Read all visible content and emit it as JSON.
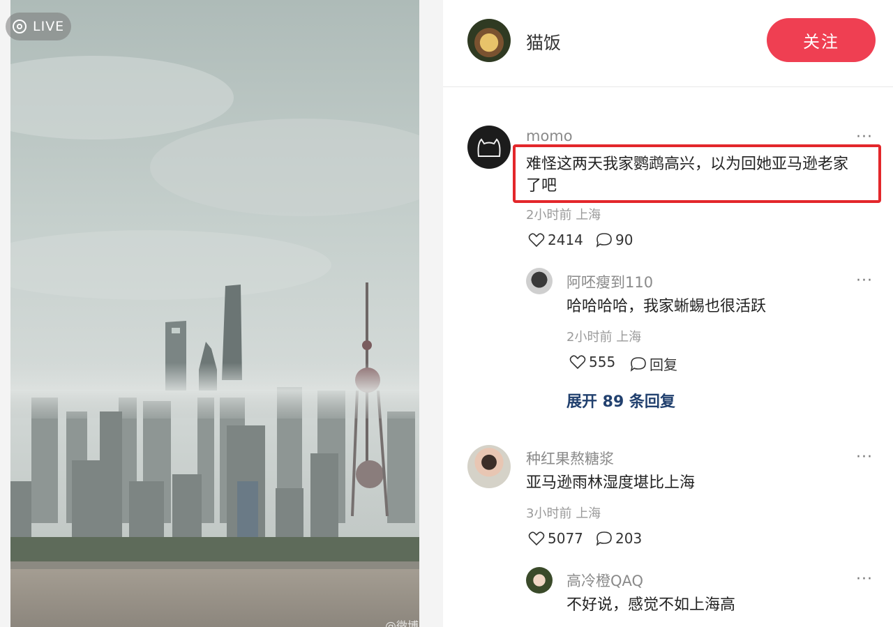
{
  "photo": {
    "live_label": "LIVE",
    "watermark": "@微博"
  },
  "header": {
    "author_name": "猫饭",
    "follow_label": "关注"
  },
  "comments": [
    {
      "user": "momo",
      "text_line1": "难怪这两天我家鹦鹉高兴，以为回她亚马逊老家",
      "text_line2": "了吧",
      "time": "2小时前",
      "location": "上海",
      "likes": "2414",
      "replies": "90",
      "highlighted": true,
      "sub_reply": {
        "user": "阿呸瘦到110",
        "text": "哈哈哈哈，我家蜥蜴也很活跃",
        "time": "2小时前",
        "location": "上海",
        "likes": "555",
        "reply_label": "回复"
      },
      "expand_label": "展开 89 条回复"
    },
    {
      "user": "种红果熬糖浆",
      "text": "亚马逊雨林湿度堪比上海",
      "time": "3小时前",
      "location": "上海",
      "likes": "5077",
      "replies": "203",
      "sub_reply": {
        "user": "高冷橙QAQ",
        "text": "不好说，感觉不如上海高"
      }
    }
  ],
  "more_label": "···",
  "colors": {
    "accent": "#ef3f52",
    "highlight_border": "#e3272b",
    "expand_link": "#21406e"
  }
}
